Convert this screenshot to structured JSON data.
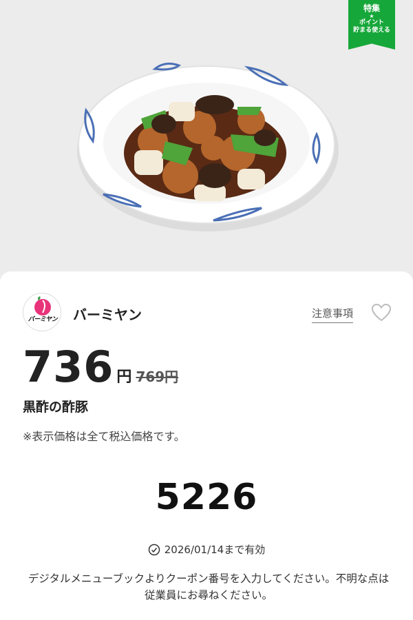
{
  "badge": {
    "title": "特集",
    "star": "★",
    "line1": "ポイント",
    "line2": "貯まる使える",
    "color": "#16a73a"
  },
  "hero": {
    "image": "sweet-and-sour-pork-dish-photo"
  },
  "store": {
    "name": "バーミヤン",
    "logo_text": "バーミヤン",
    "logo_icon": "peach-logo-icon"
  },
  "notes_link": "注意事項",
  "favorite_icon": "heart-outline-icon",
  "price": {
    "current": "736",
    "unit": "円",
    "original": "769円"
  },
  "item_name": "黒酢の酢豚",
  "tax_note": "※表示価格は全て税込価格です。",
  "coupon_code": "5226",
  "validity": {
    "icon": "clock-icon",
    "text": "2026/01/14まで有効"
  },
  "instructions": "デジタルメニューブックよりクーポン番号を入力してください。不明な点は従業員にお尋ねください。"
}
